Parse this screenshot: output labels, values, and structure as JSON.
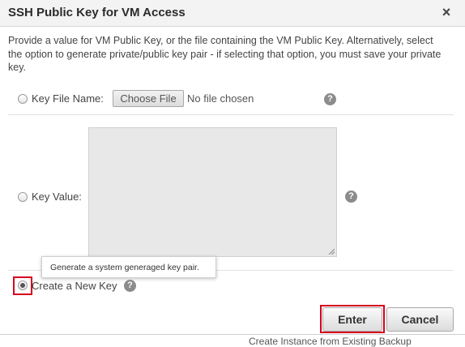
{
  "dialog": {
    "title": "SSH Public Key for VM Access",
    "close_glyph": "×",
    "description": "Provide a value for VM Public Key, or the file containing the VM Public Key. Alternatively, select the option to generate private/public key pair - if selecting that option, you must save your private key."
  },
  "options": {
    "key_file": {
      "label": "Key File Name:",
      "choose_button": "Choose File",
      "no_file_text": "No file chosen"
    },
    "key_value": {
      "label": "Key Value:"
    },
    "new_key": {
      "label": "Create a New Key",
      "selected": true
    }
  },
  "help_glyph": "?",
  "tooltip": {
    "text": "Generate a system generaged key pair."
  },
  "buttons": {
    "enter": "Enter",
    "cancel": "Cancel"
  },
  "background_text": "Create Instance from Existing Backup",
  "colors": {
    "highlight": "#d6001c",
    "help_icon": "#8c8c8c",
    "header_bg": "#f3f3f3"
  }
}
